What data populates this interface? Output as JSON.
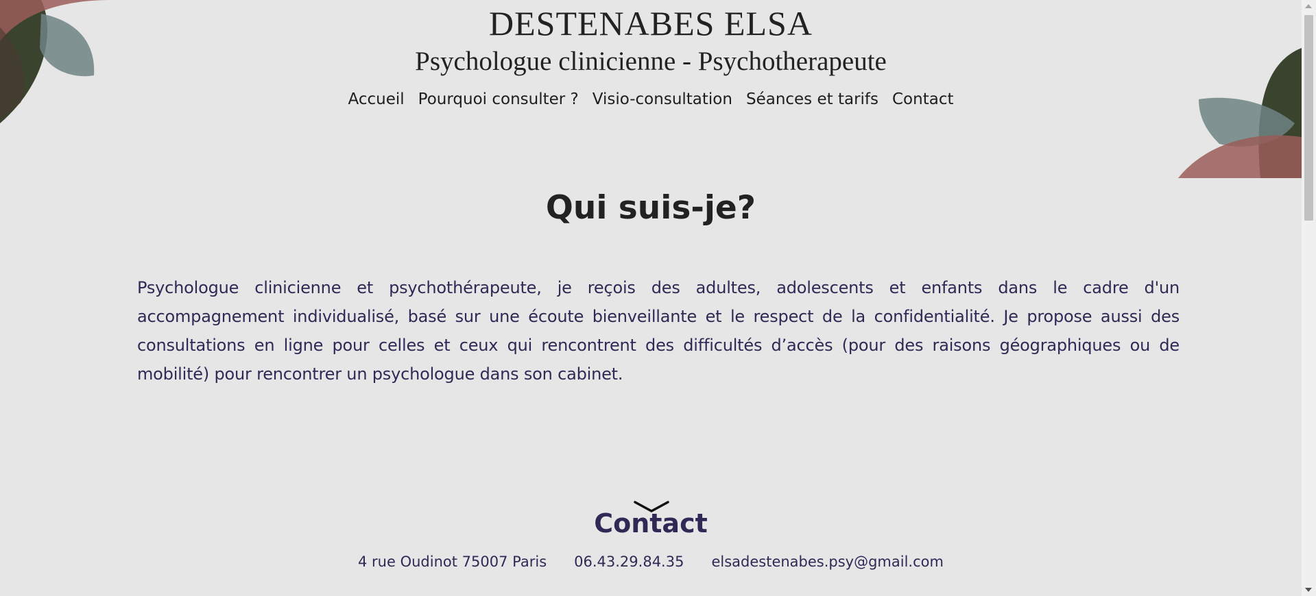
{
  "header": {
    "title": "DESTENABES ELSA",
    "subtitle": "Psychologue clinicienne - Psychotherapeute"
  },
  "nav": {
    "items": [
      {
        "label": "Accueil"
      },
      {
        "label": "Pourquoi consulter ?"
      },
      {
        "label": "Visio-consultation"
      },
      {
        "label": "Séances et tarifs"
      },
      {
        "label": "Contact"
      }
    ]
  },
  "main": {
    "heading": "Qui suis-je?",
    "intro": "Psychologue clinicienne et psychothérapeute, je reçois des adultes, adolescents et enfants dans le cadre d'un accompagnement individualisé, basé sur une écoute bienveillante et le respect de la confidentialité. Je propose aussi des consultations en ligne pour celles et ceux qui rencontrent des difficultés d’accès (pour des raisons géographiques ou de mobilité) pour rencontrer un psychologue dans son cabinet."
  },
  "contact": {
    "heading": "Contact",
    "address": "4 rue Oudinot 75007 Paris",
    "phone": "06.43.29.84.35",
    "email": "elsadestenabes.psy@gmail.com"
  },
  "icons": {
    "decoration": "petal-decoration-icon",
    "chevron": "chevron-down-icon"
  },
  "colors": {
    "background": "#e6e6e6",
    "text_dark": "#222222",
    "text_accent": "#2f2a55",
    "petal_green": "#2f3a24",
    "petal_red": "#9a5c58",
    "petal_grey": "#6e8282"
  }
}
